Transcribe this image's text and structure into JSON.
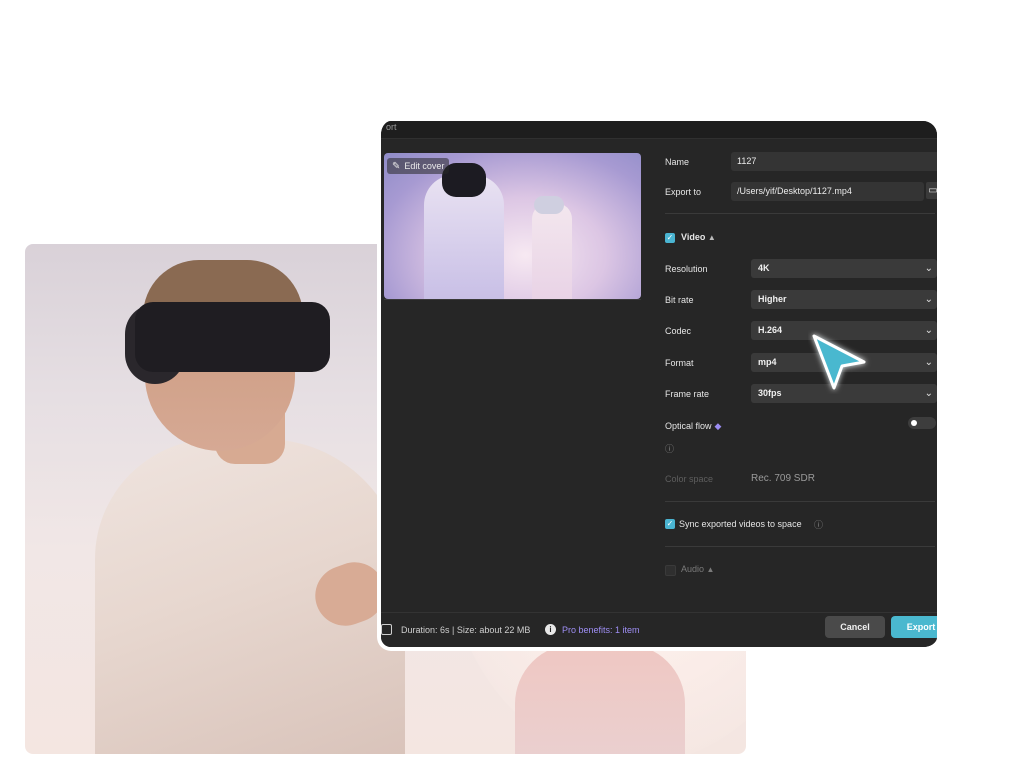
{
  "dialog": {
    "title": "ort",
    "edit_cover_label": "Edit cover",
    "name_label": "Name",
    "name_value": "1127",
    "export_to_label": "Export to",
    "export_to_value": "/Users/yif/Desktop/1127.mp4",
    "video_section": {
      "label": "Video",
      "expanded": true,
      "checked": true
    },
    "resolution": {
      "label": "Resolution",
      "value": "4K"
    },
    "bit_rate": {
      "label": "Bit rate",
      "value": "Higher"
    },
    "codec": {
      "label": "Codec",
      "value": "H.264"
    },
    "format": {
      "label": "Format",
      "value": "mp4"
    },
    "frame_rate": {
      "label": "Frame rate",
      "value": "30fps"
    },
    "optical_flow": {
      "label": "Optical flow",
      "enabled": false
    },
    "color_space": {
      "label": "Color space",
      "value": "Rec. 709 SDR"
    },
    "sync": {
      "label": "Sync exported videos to space",
      "checked": true
    },
    "audio_section": {
      "label": "Audio",
      "checked": false
    },
    "footer": {
      "info": "Duration: 6s | Size: about 22 MB",
      "pro_benefits": "Pro benefits: 1 item",
      "cancel_label": "Cancel",
      "export_label": "Export"
    }
  },
  "colors": {
    "accent": "#4ab8cf",
    "dialog_bg": "#262626",
    "pro": "#9f8ff5"
  },
  "icons": [
    "pencil-icon",
    "folder-icon",
    "chevron-down-icon",
    "checkbox-icon",
    "gem-icon",
    "help-icon",
    "info-icon",
    "file-icon",
    "cursor-arrow-icon"
  ]
}
